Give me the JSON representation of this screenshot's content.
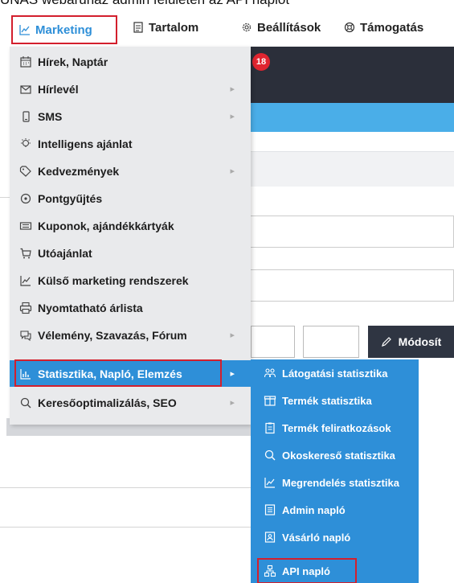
{
  "caption": "UNAS webáruház admin felületén az API naplót",
  "topnav": {
    "items": [
      {
        "label": "Marketing",
        "icon": "chart-line-icon"
      },
      {
        "label": "Tartalom",
        "icon": "document-icon"
      },
      {
        "label": "Beállítások",
        "icon": "gear-icon"
      },
      {
        "label": "Támogatás",
        "icon": "lifebuoy-icon"
      }
    ]
  },
  "background": {
    "badge_count": "18",
    "modify_button": "Módosít"
  },
  "menu": {
    "items": [
      {
        "label": "Hírek, Naptár",
        "icon": "calendar-icon",
        "has_submenu": false
      },
      {
        "label": "Hírlevél",
        "icon": "envelope-icon",
        "has_submenu": true
      },
      {
        "label": "SMS",
        "icon": "phone-icon",
        "has_submenu": true
      },
      {
        "label": "Intelligens ajánlat",
        "icon": "lightbulb-icon",
        "has_submenu": false
      },
      {
        "label": "Kedvezmények",
        "icon": "tag-icon",
        "has_submenu": true
      },
      {
        "label": "Pontgyűjtés",
        "icon": "target-icon",
        "has_submenu": false
      },
      {
        "label": "Kuponok, ajándékkártyák",
        "icon": "ticket-icon",
        "has_submenu": false
      },
      {
        "label": "Utóajánlat",
        "icon": "cart-icon",
        "has_submenu": false
      },
      {
        "label": "Külső marketing rendszerek",
        "icon": "chart-line-icon",
        "has_submenu": false
      },
      {
        "label": "Nyomtatható árlista",
        "icon": "printer-icon",
        "has_submenu": false
      },
      {
        "label": "Vélemény, Szavazás, Fórum",
        "icon": "chat-icon",
        "has_submenu": true
      },
      {
        "label": "Statisztika, Napló, Elemzés",
        "icon": "bar-chart-icon",
        "has_submenu": true,
        "active": true
      },
      {
        "label": "Keresőoptimalizálás, SEO",
        "icon": "search-icon",
        "has_submenu": true
      }
    ]
  },
  "submenu": {
    "items": [
      {
        "label": "Látogatási statisztika",
        "icon": "users-icon"
      },
      {
        "label": "Termék statisztika",
        "icon": "box-icon"
      },
      {
        "label": "Termék feliratkozások",
        "icon": "clipboard-icon"
      },
      {
        "label": "Okoskereső statisztika",
        "icon": "search-icon"
      },
      {
        "label": "Megrendelés statisztika",
        "icon": "chart-line-icon"
      },
      {
        "label": "Admin napló",
        "icon": "log-icon"
      },
      {
        "label": "Vásárló napló",
        "icon": "user-card-icon"
      },
      {
        "label": "API napló",
        "icon": "network-icon"
      }
    ]
  },
  "colors": {
    "accent": "#2e8fd8",
    "highlight": "#d31f2d",
    "menu_bg": "#e9eaec"
  }
}
